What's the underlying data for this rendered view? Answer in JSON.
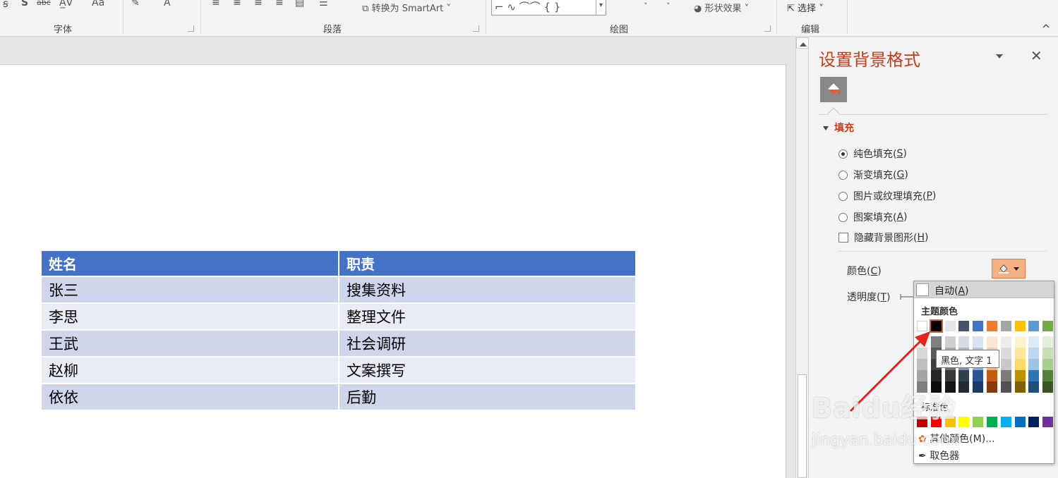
{
  "ribbon": {
    "groups": {
      "font": "字体",
      "paragraph": "段落",
      "drawing": "绘图",
      "editing": "编辑"
    },
    "convert_smartart": "转换为 SmartArt",
    "shape_effects": "形状效果",
    "select": "选择"
  },
  "table": {
    "headers": [
      "姓名",
      "职责"
    ],
    "rows": [
      [
        "张三",
        "搜集资料"
      ],
      [
        "李思",
        "整理文件"
      ],
      [
        "王武",
        "社会调研"
      ],
      [
        "赵柳",
        "文案撰写"
      ],
      [
        "依依",
        "后勤"
      ]
    ]
  },
  "pane": {
    "title": "设置背景格式",
    "section": "填充",
    "options": [
      "纯色填充(",
      "渐变填充(",
      "图片或纹理填充(",
      "图案填充("
    ],
    "option_keys": [
      "S",
      "G",
      "P",
      "A"
    ],
    "hide_bg": "隐藏背景图形(",
    "hide_bg_key": "H",
    "color_label": "颜色(",
    "color_key": "C",
    "transparency_label": "透明度(",
    "transparency_key": "T",
    "close_paren": ")",
    "selected_option": 0
  },
  "dropdown": {
    "auto": "自动(",
    "auto_key": "A",
    "theme_colors": "主题颜色",
    "standard_colors": "标准色",
    "more_colors": "其他颜色(M)...",
    "eyedropper": "取色器",
    "tooltip": "黑色, 文字 1",
    "theme_top": [
      "#ffffff",
      "#000000",
      "#e7e6e6",
      "#44546a",
      "#4472c4",
      "#ed7d31",
      "#a5a5a5",
      "#ffc000",
      "#5b9bd5",
      "#70ad47"
    ],
    "theme_shades": [
      [
        "#f2f2f2",
        "#7f7f7f",
        "#d0cece",
        "#d6dce4",
        "#d9e2f3",
        "#fbe5d5",
        "#ededed",
        "#fff2cc",
        "#deebf6",
        "#e2efd9"
      ],
      [
        "#d8d8d8",
        "#595959",
        "#aeabab",
        "#adb9ca",
        "#b4c6e7",
        "#f7caac",
        "#dbdbdb",
        "#fee599",
        "#bdd7ee",
        "#c5e0b3"
      ],
      [
        "#bfbfbf",
        "#3f3f3f",
        "#757070",
        "#8496b0",
        "#8eaadb",
        "#f4b183",
        "#c9c9c9",
        "#ffd965",
        "#9cc3e5",
        "#a8d08d"
      ],
      [
        "#a5a5a5",
        "#262626",
        "#3a3838",
        "#323f4f",
        "#2f5496",
        "#c55a11",
        "#7b7b7b",
        "#bf9000",
        "#2e75b5",
        "#538135"
      ],
      [
        "#7f7f7f",
        "#0c0c0c",
        "#171616",
        "#222a35",
        "#1f3864",
        "#833c0b",
        "#525252",
        "#7f6000",
        "#1e4e79",
        "#375623"
      ]
    ],
    "standard": [
      "#c00000",
      "#ff0000",
      "#ffc000",
      "#ffff00",
      "#92d050",
      "#00b050",
      "#00b0f0",
      "#0070c0",
      "#002060",
      "#7030a0"
    ]
  },
  "watermark": {
    "brand": "Baidu经验",
    "url": "jingyan.baidu.com"
  }
}
